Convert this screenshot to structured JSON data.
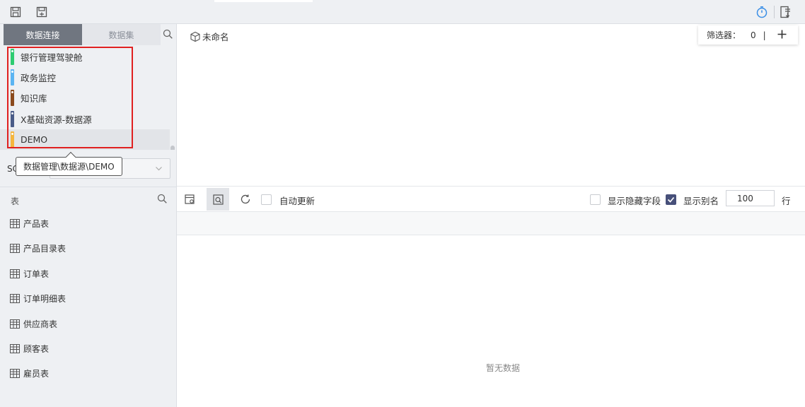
{
  "toolbar": {
    "save_icon": "save-icon",
    "save_as_icon": "save-as-icon",
    "timer_icon": "stopwatch-icon",
    "export_icon": "export-icon"
  },
  "left_tabs": [
    {
      "label": "数据连接",
      "active": true
    },
    {
      "label": "数据集",
      "active": false
    }
  ],
  "connections": [
    {
      "label": "银行管理驾驶舱",
      "color": "#2ecc71"
    },
    {
      "label": "政务监控",
      "color": "#5ab4f2"
    },
    {
      "label": "知识库",
      "color": "#8b4a1d"
    },
    {
      "label": "X基础资源-数据源",
      "color": "#4a5c88"
    },
    {
      "label": "DEMO",
      "color": "#f5b53d",
      "selected": true
    }
  ],
  "tooltip": "数据管理\\数据源\\DEMO",
  "schema": {
    "label": "SC",
    "value": ""
  },
  "tables": {
    "header": "表",
    "items": [
      "产品表",
      "产品目录表",
      "订单表",
      "订单明细表",
      "供应商表",
      "顾客表",
      "雇员表"
    ]
  },
  "main": {
    "dataset_name": "未命名",
    "filter": {
      "label": "筛选器：",
      "count": "0",
      "sep": "|"
    },
    "auto_update_label": "自动更新",
    "show_hidden_label": "显示隐藏字段",
    "show_alias_label": "显示别名",
    "show_alias_checked": true,
    "show_hidden_checked": false,
    "auto_update_checked": false,
    "rows_value": "100",
    "rows_unit": "行",
    "empty_text": "暂无数据"
  },
  "colors": {
    "accent": "#47507a",
    "highlight_box": "#e02020",
    "active_tab": "#707680",
    "timer_icon": "#3a8ee6"
  }
}
